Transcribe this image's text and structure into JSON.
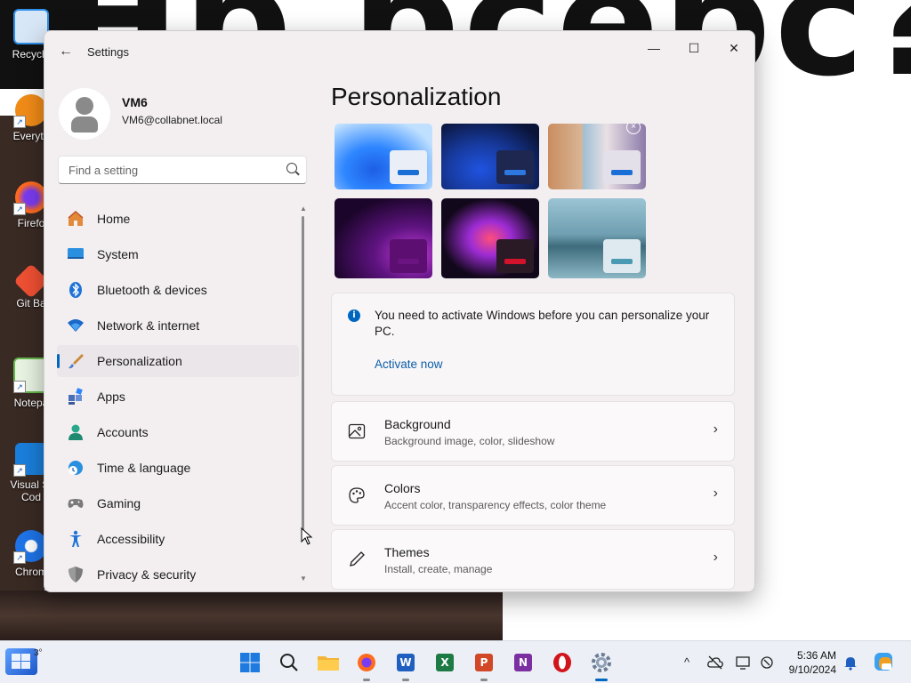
{
  "desktop": {
    "background_text": "Hb bcebc??",
    "icons": [
      {
        "label": "Recycle",
        "color": "#2f8ee8"
      },
      {
        "label": "Everyth",
        "color": "#f28c18"
      },
      {
        "label": "Firefo",
        "color": "#ff6a1f"
      },
      {
        "label": "Git Ba",
        "color": "#f05033"
      },
      {
        "label": "Notepa",
        "color": "#63b84a"
      },
      {
        "label": "Visual St Cod",
        "color": "#1a7fdc"
      },
      {
        "label": "Chrom",
        "color": "#1e74e8"
      }
    ]
  },
  "window": {
    "title": "Settings",
    "controls": {
      "minimize": "—",
      "maximize": "☐",
      "close": "✕"
    }
  },
  "profile": {
    "name": "VM6",
    "email": "VM6@collabnet.local"
  },
  "search": {
    "placeholder": "Find a setting"
  },
  "nav": {
    "items": [
      {
        "label": "Home",
        "icon": "home-icon",
        "color": "#e38a3a"
      },
      {
        "label": "System",
        "icon": "monitor-icon",
        "color": "#2b8fe0"
      },
      {
        "label": "Bluetooth & devices",
        "icon": "bluetooth-icon",
        "color": "#1f73d6"
      },
      {
        "label": "Network & internet",
        "icon": "wifi-icon",
        "color": "#1a68c9"
      },
      {
        "label": "Personalization",
        "icon": "brush-icon",
        "color": "#e0a050",
        "active": true
      },
      {
        "label": "Apps",
        "icon": "apps-icon",
        "color": "#4a6fb7"
      },
      {
        "label": "Accounts",
        "icon": "person-icon",
        "color": "#27a88a"
      },
      {
        "label": "Time & language",
        "icon": "globe-clock-icon",
        "color": "#2b8fe0"
      },
      {
        "label": "Gaming",
        "icon": "gamepad-icon",
        "color": "#7a7a7a"
      },
      {
        "label": "Accessibility",
        "icon": "accessibility-icon",
        "color": "#1f73d6"
      },
      {
        "label": "Privacy & security",
        "icon": "shield-icon",
        "color": "#7a7a7a"
      }
    ]
  },
  "main": {
    "title": "Personalization",
    "themes": [
      {
        "name": "theme-windows-light",
        "mini_bg": "#e9eef7",
        "bar": "#1a6fd6"
      },
      {
        "name": "theme-windows-dark",
        "mini_bg": "#1d2750",
        "bar": "#2c78e0"
      },
      {
        "name": "theme-flowers",
        "mini_bg": "#e4e0ea",
        "bar": "#1a6fd6"
      },
      {
        "name": "theme-glow",
        "mini_bg": "#5c0f70",
        "bar": "#6a1482"
      },
      {
        "name": "theme-captured-motion",
        "mini_bg": "#2a1a25",
        "bar": "#d3132b"
      },
      {
        "name": "theme-sunrise",
        "mini_bg": "#dfeaf0",
        "bar": "#4a9ab4"
      }
    ],
    "activation": {
      "message": "You need to activate Windows before you can personalize your PC.",
      "link": "Activate now"
    },
    "settings": [
      {
        "title": "Background",
        "subtitle": "Background image, color, slideshow",
        "icon": "image-icon"
      },
      {
        "title": "Colors",
        "subtitle": "Accent color, transparency effects, color theme",
        "icon": "palette-icon"
      },
      {
        "title": "Themes",
        "subtitle": "Install, create, manage",
        "icon": "pen-icon"
      }
    ]
  },
  "taskbar": {
    "weather_temp": "3°",
    "apps": [
      {
        "name": "start",
        "glyph": "",
        "color": "#1f7ae0"
      },
      {
        "name": "search",
        "glyph": "",
        "color": "#222222"
      },
      {
        "name": "file-explorer",
        "glyph": "",
        "color": "#f2b43a"
      },
      {
        "name": "firefox",
        "glyph": "",
        "color": "#ff6a1f"
      },
      {
        "name": "word",
        "glyph": "W",
        "color": "#1f5fbf"
      },
      {
        "name": "excel",
        "glyph": "X",
        "color": "#1d7a44"
      },
      {
        "name": "powerpoint",
        "glyph": "P",
        "color": "#d24726"
      },
      {
        "name": "onenote",
        "glyph": "N",
        "color": "#7b2fa0"
      },
      {
        "name": "opera",
        "glyph": "O",
        "color": "#d1141b"
      },
      {
        "name": "settings",
        "glyph": "",
        "color": "#6b7c93"
      }
    ],
    "tray": {
      "chevron": "^",
      "time": "5:36 AM",
      "date": "9/10/2024"
    }
  },
  "colors": {
    "accent": "#0067c0",
    "link": "#0a5ea8"
  }
}
